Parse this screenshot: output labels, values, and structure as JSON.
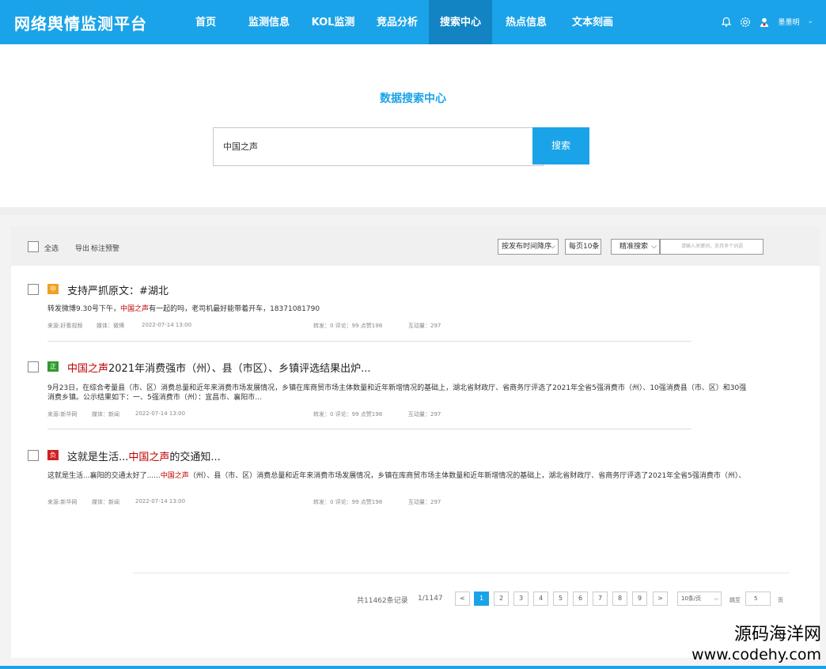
{
  "header": {
    "logo": "网络舆情监测平台",
    "nav": [
      {
        "label": "首页",
        "active": false
      },
      {
        "label": "监测信息",
        "active": false
      },
      {
        "label": "KOL监测",
        "active": false
      },
      {
        "label": "竞品分析",
        "active": false
      },
      {
        "label": "搜索中心",
        "active": true
      },
      {
        "label": "热点信息",
        "active": false
      },
      {
        "label": "文本刻画",
        "active": false
      }
    ],
    "icons": [
      "bell-icon",
      "gear-icon",
      "user-avatar-icon"
    ],
    "username": "墨墨明",
    "accent": "#1aa3e8"
  },
  "search": {
    "title": "数据搜索中心",
    "query": "中国之声",
    "button": "搜索"
  },
  "toolbar": {
    "select_all": "全选",
    "export": "导出",
    "mark_alert": "标注预警",
    "sort": "按发布时间降序",
    "per_page": "每页10条",
    "precise": "精准搜索",
    "keyword_placeholder": "请输入关键词，支持多个词语"
  },
  "results": [
    {
      "tag": "中",
      "tag_color": "#f0a020",
      "title_pre": "支持严抓原文：#湖北",
      "title_hl": "",
      "title_post": "",
      "snippet_pre": "转发微博9.30号下午，",
      "snippet_hl": "中国之声",
      "snippet_post": "有一起的吗，老司机最好能带着开车，18371081790",
      "source": "来源:好看视频",
      "media": "媒体：微博",
      "date": "2022-07-14  13:00",
      "stats": "转发：0  评论：99  点赞198",
      "interact": "互动量：297"
    },
    {
      "tag": "正",
      "tag_color": "#2e9a2e",
      "title_pre": "",
      "title_hl": "中国之声",
      "title_post": "2021年消费强市（州）、县（市区）、乡镇评选结果出炉...",
      "snippet_pre": "9月23日，在综合考量县（市、区）消费总量和近年来消费市场发展情况，乡镇在库商贸市场主体数量和近年新增情况的基础上，湖北省财政厅、省商务厅评选了2021年全省5强消费市（州）、10强消费县（市、区）和30强消费乡镇。公示结果如下：一、5强消费市（州）：宜昌市、襄阳市...",
      "snippet_hl": "",
      "snippet_post": "",
      "source": "来源:新华网",
      "media": "媒体：新闻",
      "date": "2022-07-14  13:00",
      "stats": "转发：0  评论：99  点赞198",
      "interact": "互动量：297"
    },
    {
      "tag": "负",
      "tag_color": "#d02020",
      "title_pre": "这就是生活...",
      "title_hl": "中国之声",
      "title_post": "的交通知...",
      "snippet_pre": "这就是生活...襄阳的交通太好了......",
      "snippet_hl": "中国之声",
      "snippet_post": "（州）、县（市、区）消费总量和近年来消费市场发展情况，乡镇在库商贸市场主体数量和近年新增情况的基础上，湖北省财政厅、省商务厅评选了2021年全省5强消费市（州）、",
      "source": "来源:新华网",
      "media": "媒体：新闻",
      "date": "2022-07-14  13:00",
      "stats": "转发：0  评论：99  点赞198",
      "interact": "互动量：297"
    }
  ],
  "pagination": {
    "total": "共11462条记录",
    "page_info": "1/1147",
    "prev": "<",
    "pages": [
      "1",
      "2",
      "3",
      "4",
      "5",
      "6",
      "7",
      "8",
      "9"
    ],
    "current": "1",
    "next": ">",
    "page_size": "10条/页",
    "goto_label": "跳至",
    "goto_value": "5",
    "page_suffix": "页"
  },
  "watermark": {
    "line1": "源码海洋网",
    "line2": "www.codehy.com"
  }
}
